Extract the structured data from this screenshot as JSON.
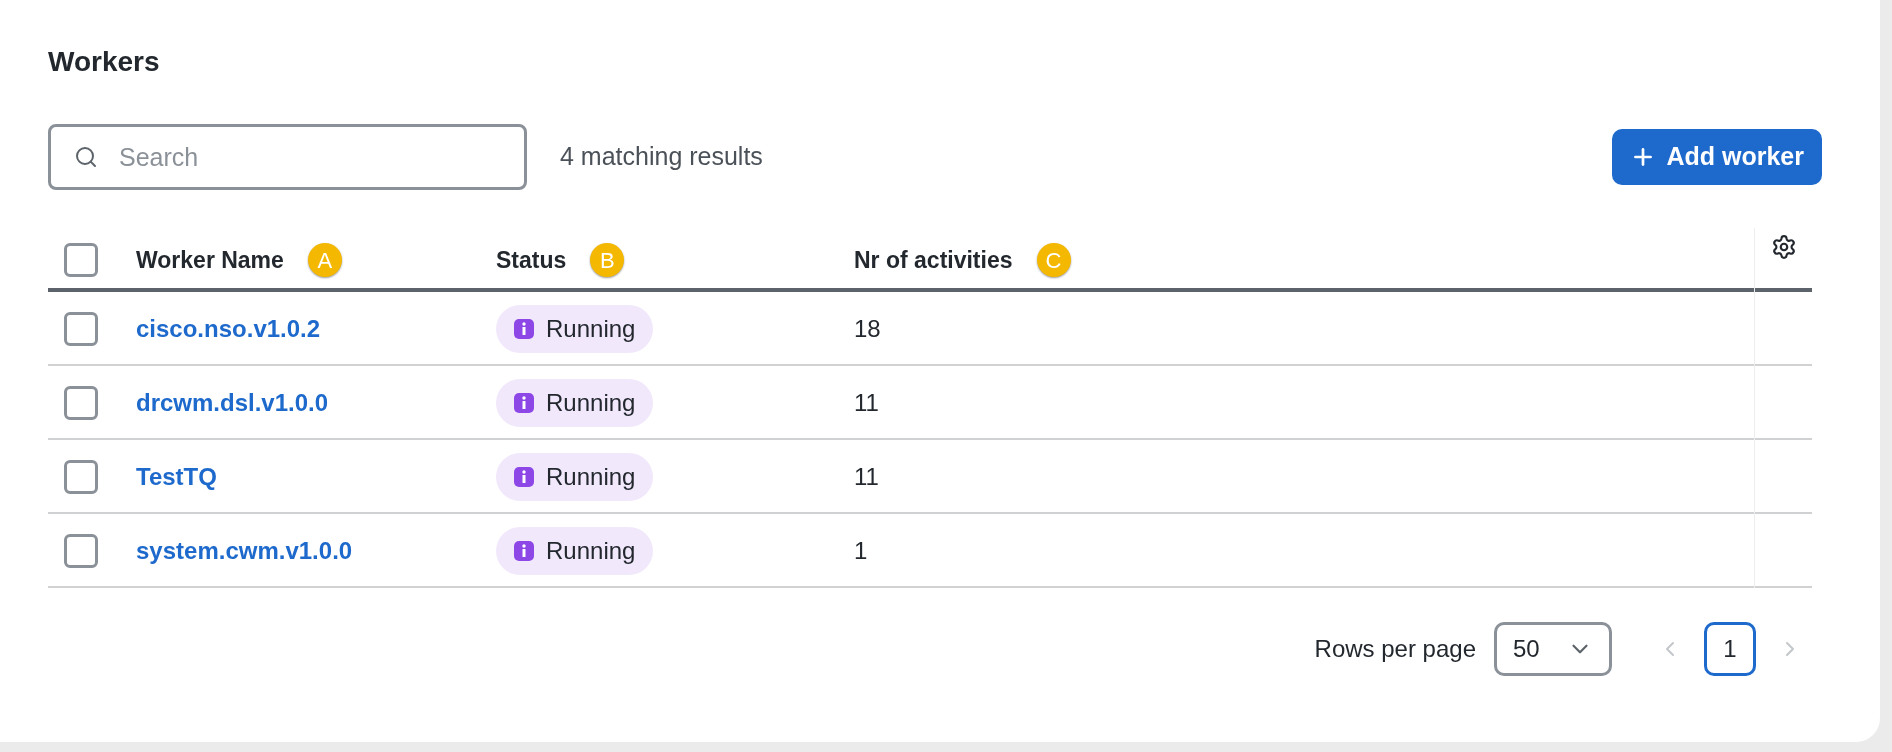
{
  "title": "Workers",
  "search": {
    "placeholder": "Search"
  },
  "result_count": "4 matching results",
  "add_button": {
    "label": "Add worker"
  },
  "table": {
    "select_all": {
      "checked": false
    },
    "columns": [
      {
        "label": "Worker Name",
        "marker": "A"
      },
      {
        "label": "Status",
        "marker": "B"
      },
      {
        "label": "Nr of activities",
        "marker": "C"
      }
    ],
    "rows": [
      {
        "checked": false,
        "name": "cisco.nso.v1.0.2",
        "status": "Running",
        "activities": "18"
      },
      {
        "checked": false,
        "name": "drcwm.dsl.v1.0.0",
        "status": "Running",
        "activities": "11"
      },
      {
        "checked": false,
        "name": "TestTQ",
        "status": "Running",
        "activities": "11"
      },
      {
        "checked": false,
        "name": "system.cwm.v1.0.0",
        "status": "Running",
        "activities": "1"
      }
    ]
  },
  "pagination": {
    "rows_per_page_label": "Rows per page",
    "rows_per_page": "50",
    "prev_disabled": true,
    "next_disabled": true,
    "pages": [
      {
        "label": "1",
        "selected": true
      }
    ]
  }
}
